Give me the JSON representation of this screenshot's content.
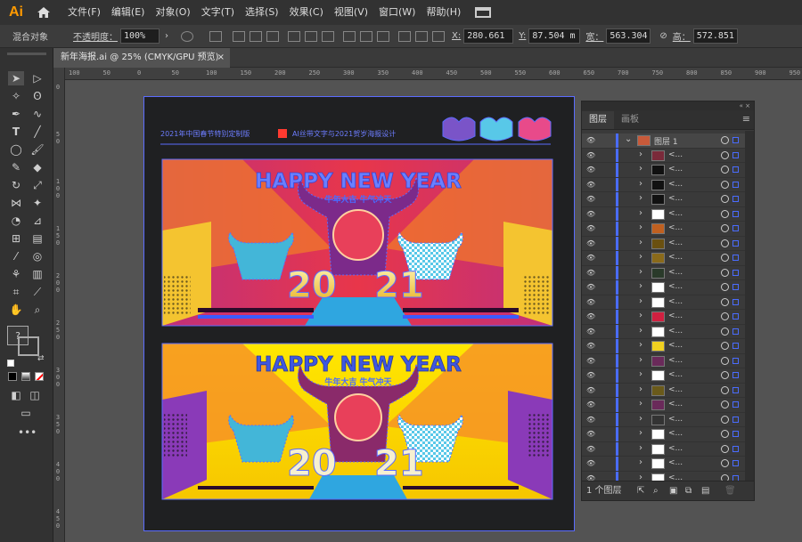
{
  "app": {
    "logo": "Ai",
    "accent": "#ff9a00"
  },
  "menu": [
    "文件(F)",
    "编辑(E)",
    "对象(O)",
    "文字(T)",
    "选择(S)",
    "效果(C)",
    "视图(V)",
    "窗口(W)",
    "帮助(H)"
  ],
  "control": {
    "object_type": "混合对象",
    "opacity_label": "不透明度：",
    "opacity_value": "100%",
    "x_label": "X:",
    "x_value": "280.661",
    "y_label": "Y:",
    "y_value": "87.504 m",
    "w_label": "宽：",
    "w_value": "563.304",
    "h_label": "高：",
    "h_value": "572.851"
  },
  "document": {
    "tab_title": "新年海报.ai @ 25% (CMYK/GPU 预览)",
    "close": "×"
  },
  "ruler": {
    "top": [
      "100",
      "50",
      "0",
      "50",
      "100",
      "150",
      "200",
      "250",
      "300",
      "350",
      "400",
      "450",
      "500",
      "550",
      "600",
      "650",
      "700",
      "750",
      "800",
      "850",
      "900",
      "950"
    ],
    "left": [
      "0",
      "50",
      "100",
      "150",
      "200",
      "250",
      "300",
      "350",
      "400",
      "450"
    ]
  },
  "artwork": {
    "header_text_left": "2021年中国春节特别定制版",
    "header_text_right": "AI丝带文字与2021贺岁海报设计",
    "poster1": {
      "title": "HAPPY NEW YEAR",
      "subtitle": "牛年大吉 牛气冲天",
      "year_a": "20",
      "year_b": "21"
    },
    "poster2": {
      "title": "HAPPY NEW YEAR",
      "subtitle": "牛年大吉 牛气冲天",
      "year_a": "20",
      "year_b": "21"
    }
  },
  "layers_panel": {
    "tabs": [
      "图层",
      "画板"
    ],
    "menu": "≡",
    "top_layer": "图层 1",
    "sub_label": "<...",
    "row_count": 23,
    "footer": "1 个图层",
    "colors": {
      "selection": "#4a6cff"
    }
  },
  "icons": [
    "home-icon",
    "selection-tool-icon",
    "direct-selection-icon",
    "pen-icon",
    "type-icon",
    "ellipse-icon",
    "brush-icon",
    "eraser-icon",
    "rotate-icon",
    "scale-icon",
    "width-icon",
    "eyedropper-icon",
    "graph-icon",
    "hand-icon",
    "zoom-icon",
    "eye-icon",
    "expand-chevron-icon",
    "target-circle-icon",
    "new-layer-icon",
    "delete-icon"
  ]
}
